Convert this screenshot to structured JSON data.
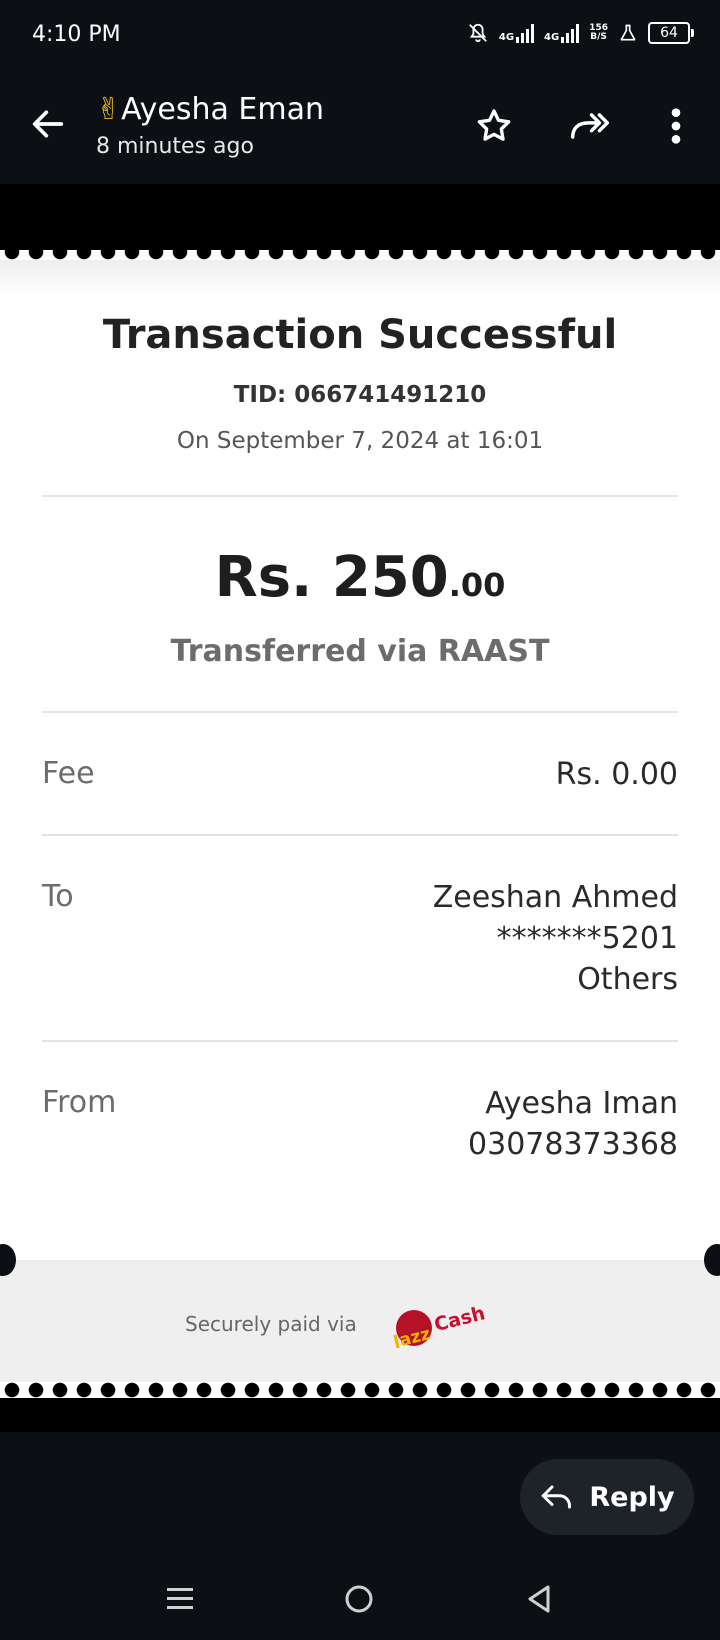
{
  "status_bar": {
    "time": "4:10 PM",
    "net1": "4G",
    "net2": "4G",
    "speed_top": "156",
    "speed_bottom": "B/S",
    "battery": "64",
    "icons": [
      "notifications-off-icon",
      "signal-icon",
      "signal-icon",
      "lab-icon",
      "battery-icon"
    ]
  },
  "header": {
    "emoji": "✌",
    "sender": "Ayesha Eman",
    "time_ago": "8 minutes ago",
    "icons": [
      "back-arrow-icon",
      "star-icon",
      "forward-icon",
      "more-vert-icon"
    ]
  },
  "receipt": {
    "title": "Transaction Successful",
    "tid": "TID: 066741491210",
    "date": "On September 7, 2024 at 16:01",
    "amount_main": "Rs. 250",
    "amount_cents": ".00",
    "method": "Transferred via RAAST",
    "fee_label": "Fee",
    "fee_value": "Rs. 0.00",
    "to_label": "To",
    "to_lines": [
      "Zeeshan Ahmed",
      "*******5201",
      "Others"
    ],
    "from_label": "From",
    "from_lines": [
      "Ayesha Iman",
      "03078373368"
    ],
    "secure_text": "Securely paid via",
    "logo_text_1": "Jazz",
    "logo_text_2": "Cash"
  },
  "reply": {
    "label": "Reply"
  },
  "navbar": {
    "icons": [
      "menu-icon",
      "home-circle-icon",
      "back-triangle-icon"
    ]
  },
  "colors": {
    "background": "#0c1014",
    "receipt": "#ffffff",
    "jazz_red": "#c8102e",
    "jazz_yellow": "#f7b500"
  }
}
